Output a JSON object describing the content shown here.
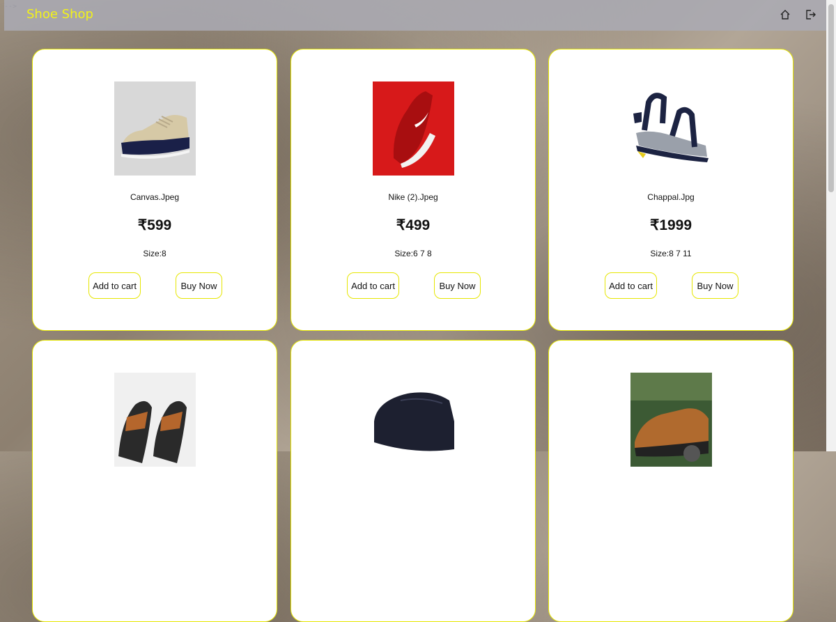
{
  "header": {
    "brand": "Shoe Shop",
    "corner_mark": "-->",
    "icons": [
      "home-icon",
      "logout-icon"
    ],
    "brand_color": "#f2f21a"
  },
  "products": [
    {
      "name": "Canvas.Jpeg",
      "price": "₹599",
      "size": "Size:8",
      "cart_label": "Add to cart",
      "buy_label": "Buy Now",
      "image": "canvas-shoe"
    },
    {
      "name": "Nike (2).Jpeg",
      "price": "₹499",
      "size": "Size:6 7 8",
      "cart_label": "Add to cart",
      "buy_label": "Buy Now",
      "image": "red-nike-shoe"
    },
    {
      "name": "Chappal.Jpg",
      "price": "₹1999",
      "size": "Size:8 7 11",
      "cart_label": "Add to cart",
      "buy_label": "Buy Now",
      "image": "sport-sandal"
    },
    {
      "name": "",
      "price": "",
      "size": "",
      "cart_label": "",
      "buy_label": "",
      "image": "flip-flop"
    },
    {
      "name": "",
      "price": "",
      "size": "",
      "cart_label": "",
      "buy_label": "",
      "image": "clog"
    },
    {
      "name": "",
      "price": "",
      "size": "",
      "cart_label": "",
      "buy_label": "",
      "image": "hiking-shoe"
    }
  ],
  "colors": {
    "card_border": "#e6e600",
    "navbar": "#aaaab4"
  }
}
